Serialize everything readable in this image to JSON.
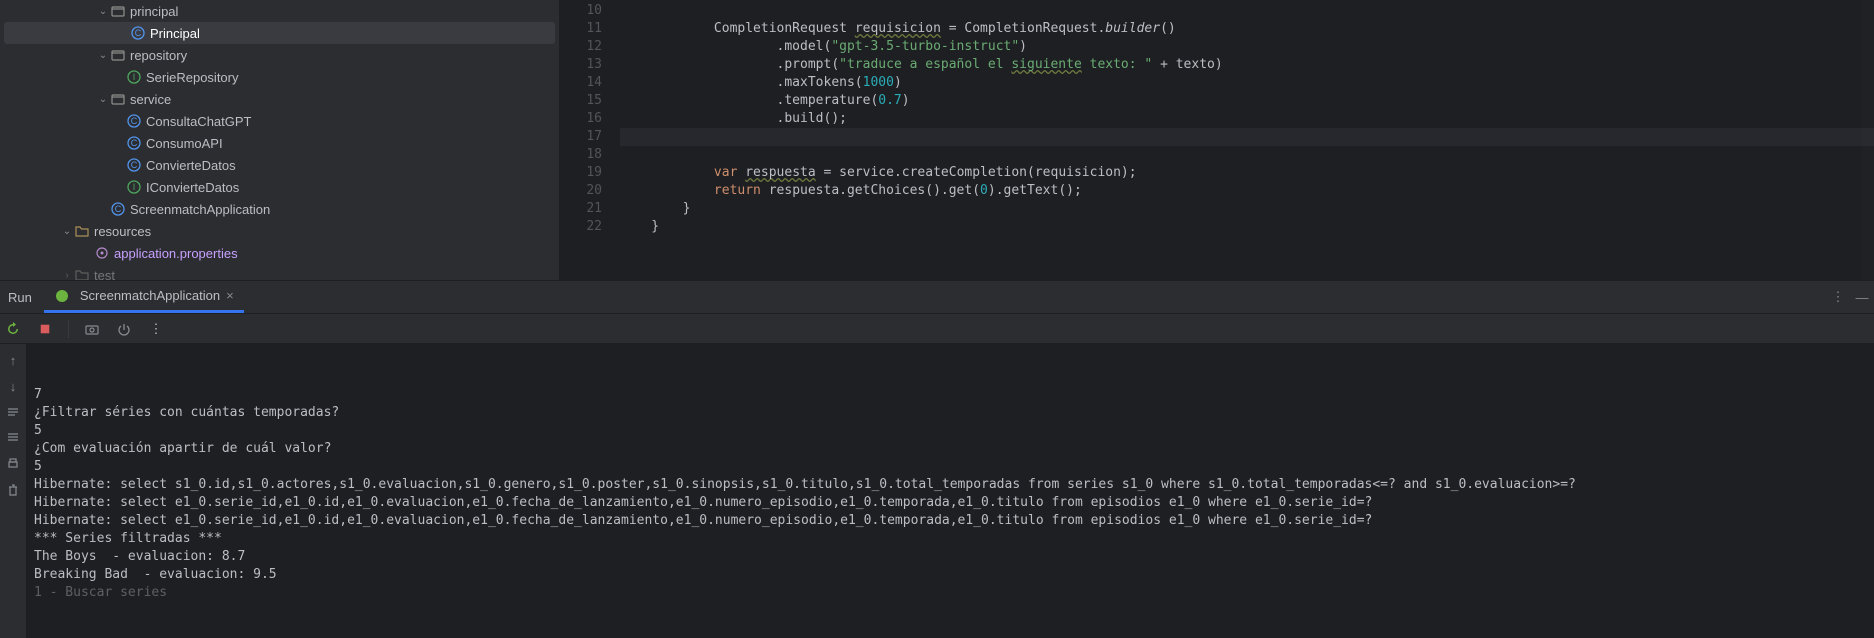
{
  "tree": {
    "principal_pkg": "principal",
    "principal_cls": "Principal",
    "repository_pkg": "repository",
    "serierepo": "SerieRepository",
    "service_pkg": "service",
    "consulta": "ConsultaChatGPT",
    "consumo": "ConsumoAPI",
    "convierte": "ConvierteDatos",
    "iconvierte": "IConvierteDatos",
    "screenapp": "ScreenmatchApplication",
    "resources": "resources",
    "appprops": "application.properties",
    "test": "test"
  },
  "editor": {
    "lines": {
      "l10": "",
      "l11a": "            CompletionRequest ",
      "l11b": "requisicion",
      "l11c": " = CompletionRequest.",
      "l11d": "builder",
      "l11e": "()",
      "l12a": "                    .model(",
      "l12b": "\"gpt-3.5-turbo-instruct\"",
      "l12c": ")",
      "l13a": "                    .prompt(",
      "l13b": "\"traduce a español el ",
      "l13c": "siguiente",
      "l13d": " texto: \"",
      "l13e": " + texto)",
      "l14a": "                    .maxTokens(",
      "l14b": "1000",
      "l14c": ")",
      "l15a": "                    .temperature(",
      "l15b": "0.7",
      "l15c": ")",
      "l16a": "                    .build();",
      "l17": "",
      "l18": "",
      "l19a": "            ",
      "l19b": "var",
      "l19c": " ",
      "l19d": "respuesta",
      "l19e": " = service.createCompletion(requisicion);",
      "l20a": "            ",
      "l20b": "return",
      "l20c": " respuesta.getChoices().get(",
      "l20d": "0",
      "l20e": ").getText();",
      "l21": "        }",
      "l22": "    }"
    },
    "gutter": [
      "10",
      "11",
      "12",
      "13",
      "14",
      "15",
      "16",
      "17",
      "18",
      "19",
      "20",
      "21",
      "22"
    ]
  },
  "run": {
    "label": "Run",
    "tab": "ScreenmatchApplication"
  },
  "console": {
    "lines": [
      "7",
      "¿Filtrar séries con cuántas temporadas?",
      "5",
      "¿Com evaluación apartir de cuál valor?",
      "5",
      "Hibernate: select s1_0.id,s1_0.actores,s1_0.evaluacion,s1_0.genero,s1_0.poster,s1_0.sinopsis,s1_0.titulo,s1_0.total_temporadas from series s1_0 where s1_0.total_temporadas<=? and s1_0.evaluacion>=?",
      "Hibernate: select e1_0.serie_id,e1_0.id,e1_0.evaluacion,e1_0.fecha_de_lanzamiento,e1_0.numero_episodio,e1_0.temporada,e1_0.titulo from episodios e1_0 where e1_0.serie_id=?",
      "Hibernate: select e1_0.serie_id,e1_0.id,e1_0.evaluacion,e1_0.fecha_de_lanzamiento,e1_0.numero_episodio,e1_0.temporada,e1_0.titulo from episodios e1_0 where e1_0.serie_id=?",
      "*** Series filtradas ***",
      "The Boys  - evaluacion: 8.7",
      "Breaking Bad  - evaluacion: 9.5",
      "1 - Buscar series"
    ]
  }
}
